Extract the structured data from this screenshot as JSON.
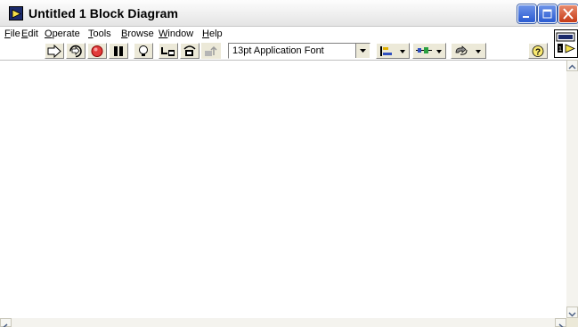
{
  "window": {
    "title": "Untitled 1 Block Diagram",
    "title_icon": "labview-vi-icon"
  },
  "window_controls": [
    {
      "name": "minimize",
      "icon": "minimize-icon"
    },
    {
      "name": "maximize",
      "icon": "maximize-icon"
    },
    {
      "name": "close",
      "icon": "close-icon"
    }
  ],
  "menu": {
    "items": [
      {
        "label": "File",
        "underline": "F",
        "rest": "ile"
      },
      {
        "label": "Edit",
        "underline": "E",
        "rest": "dit"
      },
      {
        "label": "Operate",
        "underline": "O",
        "rest": "perate"
      },
      {
        "label": "Tools",
        "underline": "T",
        "rest": "ools"
      },
      {
        "label": "Browse",
        "underline": "B",
        "rest": "rowse"
      },
      {
        "label": "Window",
        "underline": "W",
        "rest": "indow"
      },
      {
        "label": "Help",
        "underline": "H",
        "rest": "elp"
      }
    ]
  },
  "toolbar": {
    "font_ring_value": "13pt Application Font",
    "buttons": [
      "run-arrow-icon",
      "run-continuously-icon",
      "abort-icon",
      "pause-icon",
      "highlight-execution-icon",
      "step-into-icon",
      "step-over-icon",
      "step-out-icon",
      "align-objects-icon",
      "distribute-objects-icon",
      "reorder-icon",
      "context-help-icon"
    ]
  },
  "colors": {
    "titlebar_bg": "#f3f3f3",
    "close_button": "#c53a16",
    "xp_blue": "#2a5bd1",
    "abort_red": "#d01010",
    "diagram_bg": "#ffffff"
  }
}
